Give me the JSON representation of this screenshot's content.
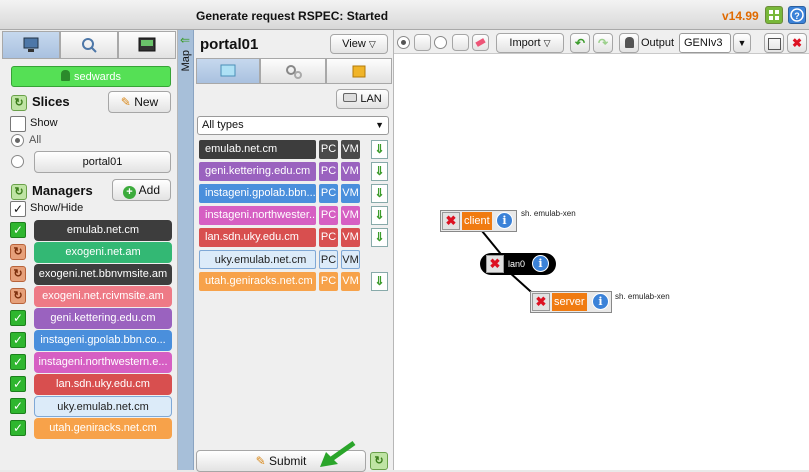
{
  "window": {
    "title": "Generate request RSPEC: Started",
    "version": "v14.99"
  },
  "left": {
    "user": "sedwards",
    "slices": {
      "title": "Slices",
      "new_label": "New",
      "show_label": "Show",
      "all_label": "All",
      "slice_button": "portal01"
    },
    "managers": {
      "title": "Managers",
      "add_label": "Add",
      "show_hide": "Show/Hide",
      "items": [
        {
          "label": "emulab.net.cm",
          "color": "#3d3d3d",
          "state": "check"
        },
        {
          "label": "exogeni.net.am",
          "color": "#33b874",
          "state": "refresh"
        },
        {
          "label": "exogeni.net.bbnvmsite.am",
          "color": "#3d3d3d",
          "state": "refresh"
        },
        {
          "label": "exogeni.net.rcivmsite.am",
          "color": "#ee7a86",
          "state": "refresh"
        },
        {
          "label": "geni.kettering.edu.cm",
          "color": "#9a62bf",
          "state": "check"
        },
        {
          "label": "instageni.gpolab.bbn.co...",
          "color": "#4a8fdc",
          "state": "check"
        },
        {
          "label": "instageni.northwestern.e...",
          "color": "#d65fc3",
          "state": "check"
        },
        {
          "label": "lan.sdn.uky.edu.cm",
          "color": "#d84f4f",
          "state": "check"
        },
        {
          "label": "uky.emulab.net.cm",
          "color": "#dcebf9",
          "state": "check",
          "dark": true
        },
        {
          "label": "utah.geniracks.net.cm",
          "color": "#f7a24a",
          "state": "check"
        }
      ]
    }
  },
  "map_tab": "Map",
  "middle": {
    "slice_title": "portal01",
    "view_label": "View",
    "lan_label": "LAN",
    "filter": "All types",
    "resources": [
      {
        "label": "emulab.net.cm",
        "color": "#3d3d3d",
        "pc": "PC",
        "vm": "VM",
        "pc_color": "#4a4a4a",
        "vm_color": "#4a4a4a",
        "down": true
      },
      {
        "label": "geni.kettering.edu.cm",
        "color": "#9a62bf",
        "pc": "PC",
        "vm": "VM",
        "pc_color": "#9a62bf",
        "vm_color": "#9a62bf",
        "down": true
      },
      {
        "label": "instageni.gpolab.bbn....",
        "color": "#4a8fdc",
        "pc": "PC",
        "vm": "VM",
        "pc_color": "#4a8fdc",
        "vm_color": "#4a8fdc",
        "down": true
      },
      {
        "label": "instageni.northwester...",
        "color": "#d65fc3",
        "pc": "PC",
        "vm": "VM",
        "pc_color": "#d65fc3",
        "vm_color": "#d65fc3",
        "down": true
      },
      {
        "label": "lan.sdn.uky.edu.cm",
        "color": "#d84f4f",
        "pc": "PC",
        "vm": "VM",
        "pc_color": "#d84f4f",
        "vm_color": "#d84f4f",
        "down": true
      },
      {
        "label": "uky.emulab.net.cm",
        "color": "#dcebf9",
        "pc": "PC",
        "vm": "VM",
        "pc_color": "#dcebf9",
        "vm_color": "#dcebf9",
        "down": false,
        "dark": true
      },
      {
        "label": "utah.geniracks.net.cm",
        "color": "#f7a24a",
        "pc": "PC",
        "vm": "VM",
        "pc_color": "#f7a24a",
        "vm_color": "#f7a24a",
        "down": true
      }
    ],
    "submit_label": "Submit"
  },
  "toolbar": {
    "import_label": "Import",
    "output_label": "Output",
    "output_value": "GENIv3"
  },
  "canvas": {
    "client": {
      "label": "client",
      "image": "sh. emulab-xen"
    },
    "lan": {
      "label": "lan0"
    },
    "server": {
      "label": "server",
      "image": "sh. emulab-xen"
    }
  },
  "annotation": {
    "arrow_color": "#2aa52a"
  }
}
